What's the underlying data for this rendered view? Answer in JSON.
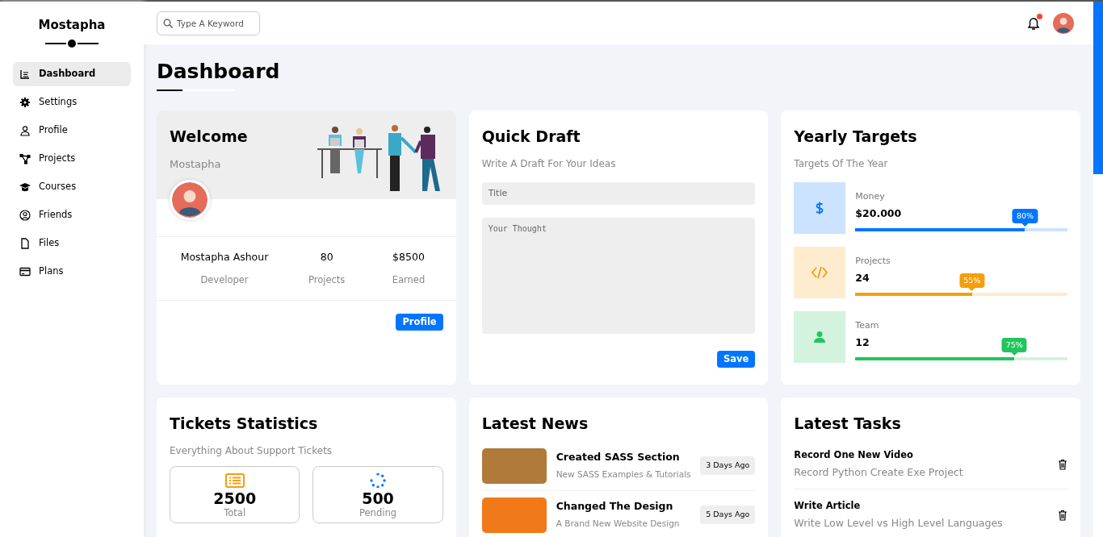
{
  "sidebar": {
    "brand": "Mostapha",
    "items": [
      {
        "label": "Dashboard",
        "selected": true
      },
      {
        "label": "Settings",
        "selected": false
      },
      {
        "label": "Profile",
        "selected": false
      },
      {
        "label": "Projects",
        "selected": false
      },
      {
        "label": "Courses",
        "selected": false
      },
      {
        "label": "Friends",
        "selected": false
      },
      {
        "label": "Files",
        "selected": false
      },
      {
        "label": "Plans",
        "selected": false
      }
    ]
  },
  "topbar": {
    "search": {
      "placeholder": "Type A Keyword"
    },
    "notification": {
      "unread": true
    }
  },
  "page_title": "Dashboard",
  "welcome": {
    "title": "Welcome",
    "subtitle": "Mostapha",
    "stats": [
      {
        "value": "Mostapha Ashour",
        "label": "Developer"
      },
      {
        "value": "80",
        "label": "Projects"
      },
      {
        "value": "$8500",
        "label": "Earned"
      }
    ],
    "button": "Profile"
  },
  "quick_draft": {
    "title": "Quick Draft",
    "subtitle": "Write A Draft For Your Ideas",
    "title_field": {
      "placeholder": "Title"
    },
    "body_field": {
      "placeholder": "Your Thought"
    },
    "button": "Save"
  },
  "yearly_targets": {
    "title": "Yearly Targets",
    "subtitle": "Targets Of The Year",
    "targets": [
      {
        "label": "Money",
        "value": "$20.000",
        "percent": "80%",
        "level": 0.8,
        "color": "#0075ff"
      },
      {
        "label": "Projects",
        "value": "24",
        "percent": "55%",
        "level": 0.55,
        "color": "#f59e0b"
      },
      {
        "label": "Team",
        "value": "12",
        "percent": "75%",
        "level": 0.75,
        "color": "#22c55e"
      }
    ]
  },
  "tickets": {
    "title": "Tickets Statistics",
    "subtitle": "Everything About Support Tickets",
    "stats": [
      {
        "value": "2500",
        "label": "Total"
      },
      {
        "value": "500",
        "label": "Pending"
      }
    ]
  },
  "news": {
    "title": "Latest News",
    "items": [
      {
        "title": "Created SASS Section",
        "subtitle": "New SASS Examples & Tutorials",
        "date": "3 Days Ago"
      },
      {
        "title": "Changed The Design",
        "subtitle": "A Brand New Website Design",
        "date": "5 Days Ago"
      }
    ]
  },
  "tasks": {
    "title": "Latest Tasks",
    "items": [
      {
        "title": "Record One New Video",
        "subtitle": "Record Python Create Exe Project"
      },
      {
        "title": "Write Article",
        "subtitle": "Write Low Level vs High Level Languages"
      }
    ]
  }
}
